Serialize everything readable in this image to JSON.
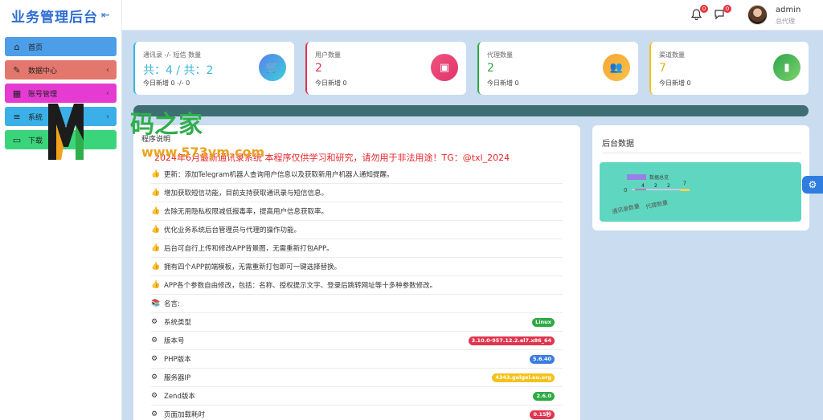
{
  "app": {
    "title": "业务管理后台",
    "collapse_icon": "collapse-left-icon"
  },
  "sidebar": {
    "items": [
      {
        "label": "首页",
        "icon": "home-icon",
        "color": "#4c9ee8",
        "has_submenu": false
      },
      {
        "label": "数据中心",
        "icon": "edit-icon",
        "color": "#e4776d",
        "has_submenu": true
      },
      {
        "label": "账号管理",
        "icon": "grid-icon",
        "color": "#e53bd2",
        "has_submenu": true
      },
      {
        "label": "系统",
        "icon": "list-icon",
        "color": "#3bb0e8",
        "has_submenu": true
      },
      {
        "label": "下载",
        "icon": "folder-icon",
        "color": "#3ad57a",
        "has_submenu": false
      }
    ]
  },
  "topbar": {
    "bell_count": "0",
    "chat_count": "0",
    "user_name": "admin",
    "user_role": "总代理"
  },
  "stats": [
    {
      "title": "通讯录 -/- 短信 数量",
      "value": "共：4 / 共：2",
      "today": "今日新增 0 -/- 0",
      "accent": "#3bb6d9",
      "value_color": "#3bb6d9",
      "icon": "cart-icon",
      "gradient": "linear-gradient(135deg,#5b7ff0,#3ad0d8)"
    },
    {
      "title": "用户数量",
      "value": "2",
      "today": "今日新增 0",
      "accent": "#e0354f",
      "value_color": "#e0354f",
      "icon": "wallet-icon",
      "gradient": "linear-gradient(135deg,#f0537f,#e0356c)"
    },
    {
      "title": "代理数量",
      "value": "2",
      "today": "今日新增 0",
      "accent": "#2eaa43",
      "value_color": "#2eaa43",
      "icon": "users-icon",
      "gradient": "linear-gradient(135deg,#f8a533,#f7c245)"
    },
    {
      "title": "渠道数量",
      "value": "7",
      "today": "今日新增 0",
      "accent": "#f3c21b",
      "value_color": "#e6b415",
      "icon": "bar-chart-icon",
      "gradient": "linear-gradient(135deg,#2fa44d,#7cd36a)"
    }
  ],
  "program": {
    "title": "程序说明",
    "notice": "2024年6月最新通讯录系统 本程序仅供学习和研究，请勿用于非法用途！TG：@txl_2024",
    "features": [
      "更新：添加Telegram机器人查询用户信息以及获取新用户机器人通知提醒。",
      "增加获取短信功能，目前支持获取通讯录与短信信息。",
      "去除无用隐私权限减低报毒率，提高用户信息获取率。",
      "优化业务系统后台管理员与代理的操作功能。",
      "后台可自行上传和修改APP背景图，无需重新打包APP。",
      "拥有四个APP前端模板，无需重新打包即可一键选择替换。",
      "APP各个参数自由修改，包括：名称、授权提示文字、登录后跳转网址等十多种参数修改。"
    ],
    "quote_label": "名言:",
    "system_info": [
      {
        "label": "系统类型",
        "value": "Linux",
        "color": "#2eaa43"
      },
      {
        "label": "版本号",
        "value": "3.10.0-957.12.2.el7.x86_64",
        "color": "#e0354f"
      },
      {
        "label": "PHP版本",
        "value": "5.6.40",
        "color": "#3b7de0"
      },
      {
        "label": "服务器IP",
        "value": "4343.golgol.eu.org",
        "color": "#f3c21b"
      },
      {
        "label": "Zend版本",
        "value": "2.6.0",
        "color": "#2eaa43"
      },
      {
        "label": "页面加载耗时",
        "value": "0.15秒",
        "color": "#e0354f"
      }
    ]
  },
  "backend": {
    "title": "后台数据",
    "chart_data": {
      "type": "bar",
      "categories": [
        "通讯录数量",
        "代理数量"
      ],
      "legend": [
        "数据总览"
      ],
      "labels": [
        "4",
        "2",
        "2",
        "7"
      ],
      "axis_zero": "0"
    }
  },
  "watermark": {
    "text_main": "码之家",
    "text_url": "www.573ym.com",
    "letter": "M"
  },
  "floating": {
    "icon": "gear-icon"
  }
}
